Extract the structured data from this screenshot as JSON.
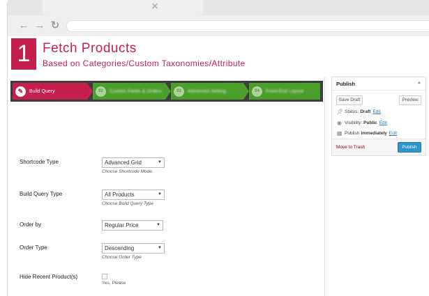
{
  "browser": {
    "tab_close": "✕",
    "back_icon": "←",
    "forward_icon": "→",
    "reload_icon": "↻"
  },
  "hero": {
    "number": "1",
    "title": "Fetch Products",
    "subtitle": "Based on Categories/Custom Taxonomies/Attribute"
  },
  "steps": [
    {
      "icon": "✎",
      "label": "Build Query"
    },
    {
      "icon": "02",
      "label": "Custom Fields & Orders"
    },
    {
      "icon": "03",
      "label": "Advanced Setting"
    },
    {
      "icon": "04",
      "label": "Front-End Layout"
    }
  ],
  "form": {
    "shortcode_type": {
      "label": "Shortcode Type",
      "value": "Advanced Grid",
      "hint": "Choose Shortcode Mode."
    },
    "build_query_type": {
      "label": "Build Query Type",
      "value": "All Products",
      "hint": "Choose Build Query Type"
    },
    "order_by": {
      "label": "Order by",
      "value": "Regular Price"
    },
    "order_type": {
      "label": "Order Type",
      "value": "Descending",
      "hint": "Choose Order Type"
    },
    "hide_recent": {
      "label": "Hide Recent Product(s)",
      "hint": "Yes, Please"
    },
    "select_arrow": "▼"
  },
  "publish": {
    "title": "Publish",
    "toggle": "▲",
    "save_draft": "Save Draft",
    "preview": "Preview",
    "status_label": "Status:",
    "status_value": "Draft",
    "visibility_label": "Visibility:",
    "visibility_value": "Public",
    "publish_label": "Publish",
    "publish_value": "immediately",
    "edit": "Edit",
    "move_to_trash": "Move to Trash",
    "publish_button": "Publish",
    "icons": {
      "status": "pin-icon",
      "visibility": "eye-icon",
      "schedule": "calendar-icon"
    }
  }
}
